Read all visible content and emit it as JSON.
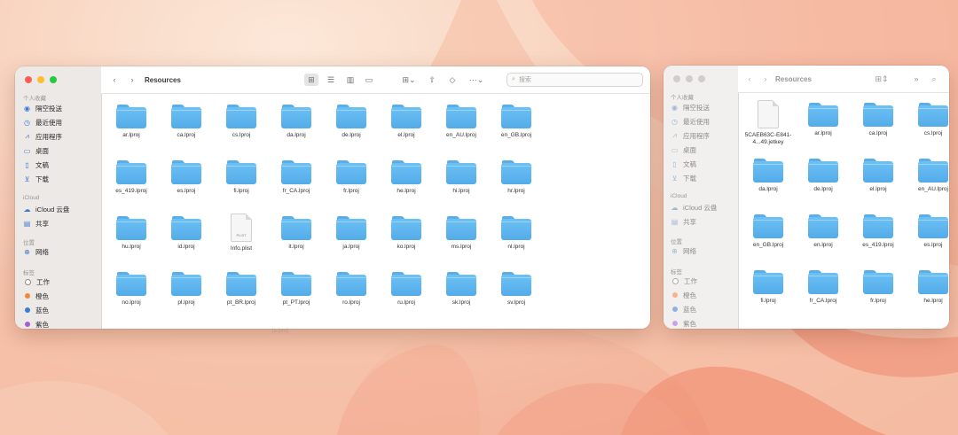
{
  "colors": {
    "close": "#ff5f57",
    "minimize": "#febc2e",
    "zoom": "#28c840",
    "inactive": "#d1cdc9",
    "folder": "#5aaee8",
    "accent": "#3a7bd5"
  },
  "left_window": {
    "title": "Resources",
    "search_placeholder": "搜索",
    "sidebar": {
      "favorites_title": "个人收藏",
      "favorites": [
        {
          "label": "隔空投送",
          "icon": "airdrop-icon"
        },
        {
          "label": "最近使用",
          "icon": "clock-icon"
        },
        {
          "label": "应用程序",
          "icon": "applications-icon"
        },
        {
          "label": "桌面",
          "icon": "desktop-icon"
        },
        {
          "label": "文稿",
          "icon": "document-icon"
        },
        {
          "label": "下载",
          "icon": "download-icon"
        }
      ],
      "icloud_title": "iCloud",
      "icloud": [
        {
          "label": "iCloud 云盘",
          "icon": "cloud-icon"
        },
        {
          "label": "共享",
          "icon": "shared-folder-icon"
        }
      ],
      "locations_title": "位置",
      "locations": [
        {
          "label": "网络",
          "icon": "network-icon"
        }
      ],
      "tags_title": "标签",
      "tags": [
        {
          "label": "工作",
          "color": "#ffffff"
        },
        {
          "label": "橙色",
          "color": "#f5853b"
        },
        {
          "label": "蓝色",
          "color": "#3a7bd5"
        },
        {
          "label": "紫色",
          "color": "#a65fd2"
        }
      ]
    },
    "items": [
      "ar.lproj",
      "ca.lproj",
      "cs.lproj",
      "da.lproj",
      "de.lproj",
      "el.lproj",
      "en_AU.lproj",
      "en_GB.lproj",
      "es_419.lproj",
      "es.lproj",
      "fi.lproj",
      "fr_CA.lproj",
      "fr.lproj",
      "he.lproj",
      "hi.lproj",
      "hr.lproj",
      "hu.lproj",
      "id.lproj",
      "Info.plist",
      "it.lproj",
      "ja.lproj",
      "ko.lproj",
      "ms.lproj",
      "nl.lproj",
      "no.lproj",
      "pl.lproj",
      "pt_BR.lproj",
      "pt_PT.lproj",
      "ro.lproj",
      "ru.lproj",
      "sk.lproj",
      "sv.lproj"
    ],
    "plist_badge": "PLIST"
  },
  "right_window": {
    "title": "Resources",
    "sidebar": {
      "favorites_title": "个人收藏",
      "favorites": [
        {
          "label": "隔空投送",
          "icon": "airdrop-icon"
        },
        {
          "label": "最近使用",
          "icon": "clock-icon"
        },
        {
          "label": "应用程序",
          "icon": "applications-icon"
        },
        {
          "label": "桌面",
          "icon": "desktop-icon"
        },
        {
          "label": "文稿",
          "icon": "document-icon"
        },
        {
          "label": "下载",
          "icon": "download-icon"
        }
      ],
      "icloud_title": "iCloud",
      "icloud": [
        {
          "label": "iCloud 云盘",
          "icon": "cloud-icon"
        },
        {
          "label": "共享",
          "icon": "shared-folder-icon"
        }
      ],
      "locations_title": "位置",
      "locations": [
        {
          "label": "网络",
          "icon": "network-icon"
        }
      ],
      "tags_title": "标签",
      "tags": [
        {
          "label": "工作",
          "color": "#ffffff"
        },
        {
          "label": "橙色",
          "color": "#f5853b"
        },
        {
          "label": "蓝色",
          "color": "#3a7bd5"
        },
        {
          "label": "紫色",
          "color": "#a65fd2"
        }
      ]
    },
    "items": [
      "5CAEB63C-E841-4...49.jetkey",
      "ar.lproj",
      "ca.lproj",
      "cs.lproj",
      "da.lproj",
      "de.lproj",
      "el.lproj",
      "en_AU.lproj",
      "en_GB.lproj",
      "en.lproj",
      "es_419.lproj",
      "es.lproj",
      "fi.lproj",
      "fr_CA.lproj",
      "fr.lproj",
      "he.lproj"
    ]
  },
  "drag_ghost": "ja.lproj"
}
